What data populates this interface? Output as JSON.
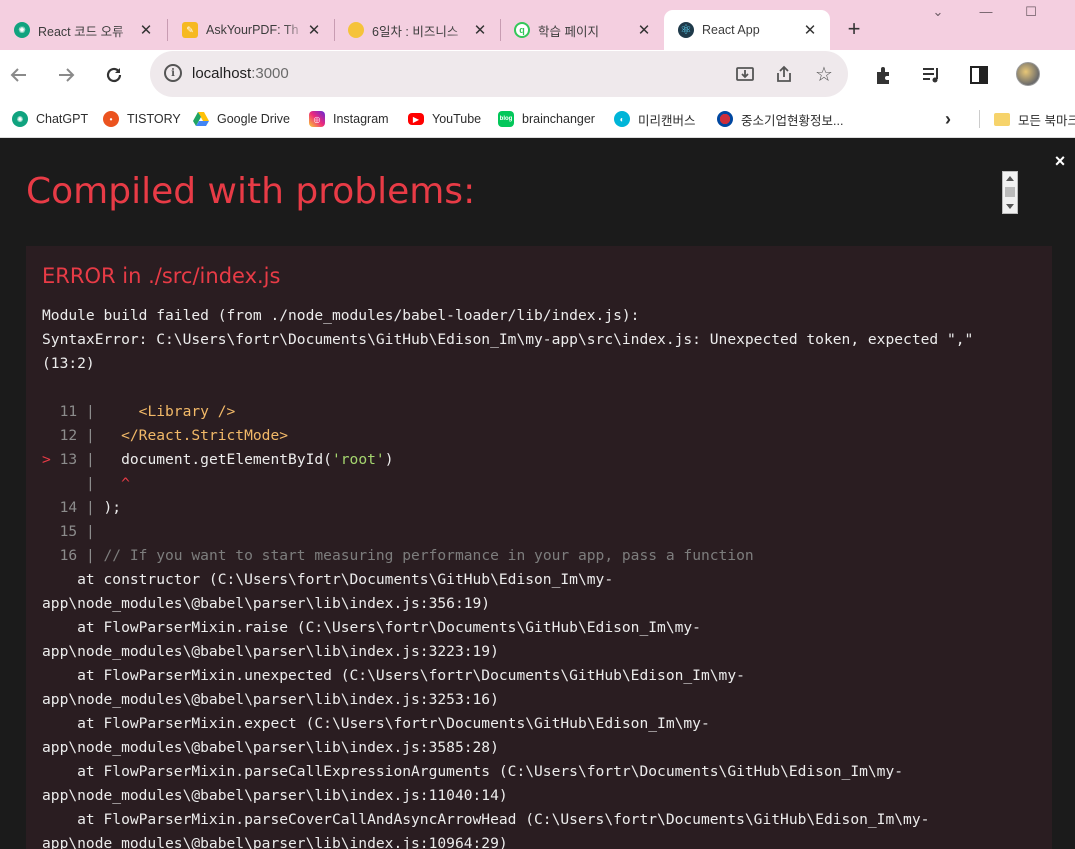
{
  "browser": {
    "tabs": [
      {
        "title": "React 코드 오류",
        "favicon": "openai-icon",
        "color": "#10a37f",
        "active": false
      },
      {
        "title": "AskYourPDF: Th",
        "favicon": "askyourpdf-icon",
        "color": "#f6b921",
        "active": false
      },
      {
        "title": "6일차 : 비즈니스",
        "favicon": "yellow-circle-icon",
        "color": "#f5c33b",
        "active": false
      },
      {
        "title": "학습 페이지",
        "favicon": "green-q-icon",
        "color": "#34c759",
        "active": false
      },
      {
        "title": "React App",
        "favicon": "react-icon",
        "color": "#1f3a4a",
        "active": true
      }
    ],
    "new_tab": "+",
    "window_controls": {
      "tab_search": "⌄",
      "minimize": "—",
      "maximize": "☐"
    },
    "url": {
      "host": "localhost",
      "port": ":3000"
    },
    "bookmarks": [
      {
        "label": "ChatGPT",
        "icon": "openai-icon",
        "color": "#10a37f"
      },
      {
        "label": "TISTORY",
        "icon": "tistory-icon",
        "color": "#eb531f"
      },
      {
        "label": "Google Drive",
        "icon": "google-drive-icon",
        "color": "#1fa463"
      },
      {
        "label": "Instagram",
        "icon": "instagram-icon",
        "color": "#d62976"
      },
      {
        "label": "YouTube",
        "icon": "youtube-icon",
        "color": "#ff0000"
      },
      {
        "label": "brainchanger",
        "icon": "blog-icon",
        "color": "#03c75a"
      },
      {
        "label": "미리캔버스",
        "icon": "miricanvas-icon",
        "color": "#00b5d8"
      },
      {
        "label": "중소기업현황정보...",
        "icon": "korea-flag-icon",
        "color": "#cd2e3a"
      }
    ],
    "bookmarks_overflow": "›",
    "other_bookmarks": "모든 북마크"
  },
  "overlay": {
    "title": "Compiled with problems:",
    "close": "×",
    "error": {
      "heading": "ERROR in ./src/index.js",
      "message_lines": [
        "Module build failed (from ./node_modules/babel-loader/lib/index.js):",
        "SyntaxError: C:\\Users\\fortr\\Documents\\GitHub\\Edison_Im\\my-app\\src\\index.js: Unexpected token, expected \",\"",
        "(13:2)"
      ],
      "code_frame": [
        {
          "marker": "",
          "line": "11",
          "code": "    <Library />",
          "kind": "tag"
        },
        {
          "marker": "",
          "line": "12",
          "code": "  </React.StrictMode>",
          "kind": "tag"
        },
        {
          "marker": ">",
          "line": "13",
          "code": "  document.getElementById(",
          "str": "'root'",
          "after": ")",
          "kind": "mixed"
        },
        {
          "marker": "",
          "line": "",
          "code": "  ^",
          "kind": "caret"
        },
        {
          "marker": "",
          "line": "14",
          "code": ");",
          "kind": "plain"
        },
        {
          "marker": "",
          "line": "15",
          "code": "",
          "kind": "plain"
        },
        {
          "marker": "",
          "line": "16",
          "code": "// If you want to start measuring performance in your app, pass a function",
          "kind": "comment"
        }
      ],
      "stack_lines": [
        "    at constructor (C:\\Users\\fortr\\Documents\\GitHub\\Edison_Im\\my-",
        "app\\node_modules\\@babel\\parser\\lib\\index.js:356:19)",
        "    at FlowParserMixin.raise (C:\\Users\\fortr\\Documents\\GitHub\\Edison_Im\\my-",
        "app\\node_modules\\@babel\\parser\\lib\\index.js:3223:19)",
        "    at FlowParserMixin.unexpected (C:\\Users\\fortr\\Documents\\GitHub\\Edison_Im\\my-",
        "app\\node_modules\\@babel\\parser\\lib\\index.js:3253:16)",
        "    at FlowParserMixin.expect (C:\\Users\\fortr\\Documents\\GitHub\\Edison_Im\\my-",
        "app\\node_modules\\@babel\\parser\\lib\\index.js:3585:28)",
        "    at FlowParserMixin.parseCallExpressionArguments (C:\\Users\\fortr\\Documents\\GitHub\\Edison_Im\\my-",
        "app\\node_modules\\@babel\\parser\\lib\\index.js:11040:14)",
        "    at FlowParserMixin.parseCoverCallAndAsyncArrowHead (C:\\Users\\fortr\\Documents\\GitHub\\Edison_Im\\my-",
        "app\\node_modules\\@babel\\parser\\lib\\index.js:10964:29)"
      ]
    }
  },
  "theme": {
    "accent": "#e83b46",
    "overlay_bg": "#1b1b1b",
    "error_bg": "#2a1d21",
    "tabstrip": "#f4cfe0"
  }
}
